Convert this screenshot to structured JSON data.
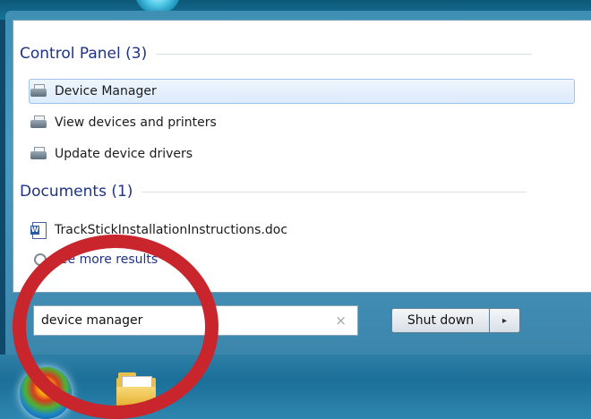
{
  "start_menu": {
    "groups": [
      {
        "header": "Control Panel (3)",
        "items": [
          {
            "label": "Device Manager",
            "icon": "device-manager-icon",
            "selected": true
          },
          {
            "label": "View devices and printers",
            "icon": "devices-printers-icon",
            "selected": false
          },
          {
            "label": "Update device drivers",
            "icon": "device-driver-icon",
            "selected": false
          }
        ]
      },
      {
        "header": "Documents (1)",
        "items": [
          {
            "label": "TrackStickInstallationInstructions.doc",
            "icon": "word-document-icon",
            "selected": false
          }
        ]
      }
    ],
    "see_more": "See more results",
    "search": {
      "value": "device manager",
      "clear_icon": "clear-icon",
      "clear_glyph": "×"
    },
    "shutdown": {
      "label": "Shut down",
      "arrow_glyph": "▸"
    }
  },
  "taskbar": {
    "items": [
      {
        "name": "start-button",
        "icon": "windows-start-orb-icon"
      },
      {
        "name": "explorer-button",
        "icon": "folder-icon"
      }
    ]
  },
  "annotation": {
    "color": "#c9252c",
    "shape": "circle"
  }
}
